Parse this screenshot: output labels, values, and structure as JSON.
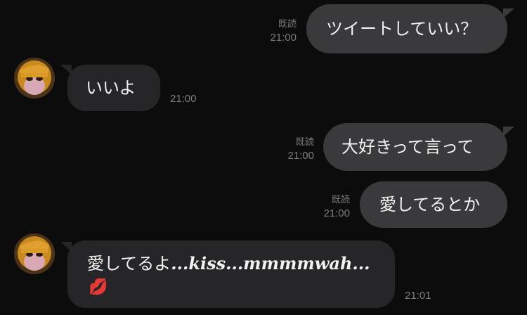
{
  "messages": [
    {
      "side": "out",
      "text": "ツイートしていい？",
      "read": "既読",
      "time": "21:00"
    },
    {
      "side": "in",
      "text": "いいよ",
      "time": "21:00"
    },
    {
      "side": "out",
      "text": "大好きって言って",
      "read": "既読",
      "time": "21:00"
    },
    {
      "side": "out",
      "text": "愛してるとか",
      "read": "既読",
      "time": "21:00"
    },
    {
      "side": "in",
      "text": "愛してるよ",
      "emphasis": "...kiss...mmmmwah...",
      "emoji": "💋",
      "time": "21:01"
    }
  ],
  "icons": {
    "avatar": "monkey-avatar-icon",
    "emoji": "lips-kiss-icon"
  },
  "colors": {
    "background": "#0c0c0d",
    "outgoing": "#3a3a3c",
    "incoming": "#262628",
    "meta": "#7c7c80"
  }
}
